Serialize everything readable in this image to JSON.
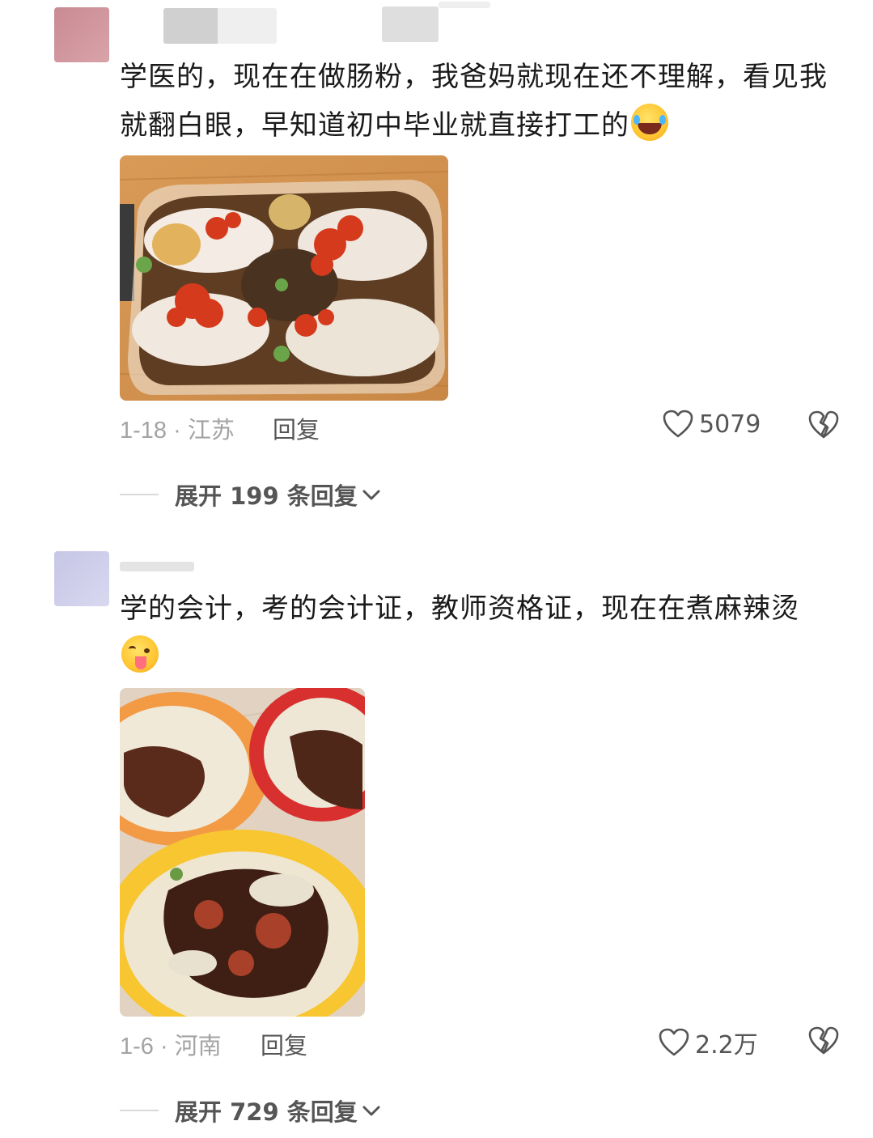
{
  "comments": [
    {
      "text": "学医的，现在在做肠粉，我爸妈就现在还不理解，看见我就翻白眼，早知道初中毕业就直接打工的",
      "emoji": "rolling-on-floor-laughing-emoji",
      "date": "1-18",
      "location": "江苏",
      "meta": "1-18 · 江苏",
      "reply_label": "回复",
      "likes": "5079",
      "expand_label": "展开 199 条回复",
      "photo": "rice-noodle-roll-photo"
    },
    {
      "text": "学的会计，考的会计证，教师资格证，现在在煮麻辣烫",
      "emoji": "winking-tongue-emoji",
      "date": "1-6",
      "location": "河南",
      "meta": "1-6 · 河南",
      "reply_label": "回复",
      "likes": "2.2万",
      "expand_label": "展开 729 条回复",
      "photo": "malatang-bowls-photo"
    }
  ],
  "icons": {
    "like": "heart-outline-icon",
    "dislike": "broken-heart-icon",
    "expand": "chevron-down-icon"
  },
  "colors": {
    "text": "#1a1a1a",
    "meta": "#a3a3a3",
    "action": "#555555"
  }
}
